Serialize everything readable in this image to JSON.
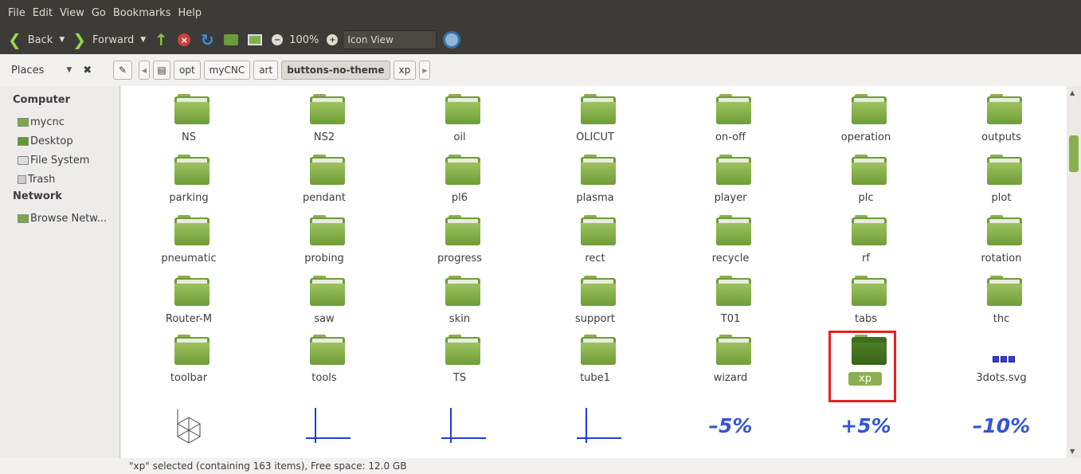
{
  "menu": [
    "File",
    "Edit",
    "View",
    "Go",
    "Bookmarks",
    "Help"
  ],
  "toolbar": {
    "back": "Back",
    "forward": "Forward",
    "zoom": "100%",
    "view_mode": "Icon View"
  },
  "location": {
    "places_label": "Places",
    "crumbs": [
      "opt",
      "myCNC",
      "art",
      "buttons-no-theme",
      "xp"
    ]
  },
  "sidebar": {
    "computer_header": "Computer",
    "computer_items": [
      "mycnc",
      "Desktop",
      "File System",
      "Trash"
    ],
    "network_header": "Network",
    "network_items": [
      "Browse Netw..."
    ]
  },
  "rows": [
    [
      "NS",
      "NS2",
      "oil",
      "OLICUT",
      "on-off",
      "operation",
      "outputs"
    ],
    [
      "parking",
      "pendant",
      "pl6",
      "plasma",
      "player",
      "plc",
      "plot"
    ],
    [
      "pneumatic",
      "probing",
      "progress",
      "rect",
      "recycle",
      "rf",
      "rotation"
    ],
    [
      "Router-M",
      "saw",
      "skin",
      "support",
      "T01",
      "tabs",
      "thc"
    ],
    [
      "toolbar",
      "tools",
      "TS",
      "tube1",
      "wizard",
      "xp",
      "3dots.svg"
    ]
  ],
  "selected_item": "xp",
  "last_row_labels": [
    "–5%",
    "+5%",
    "–10%"
  ],
  "status": "\"xp\" selected (containing 163 items), Free space: 12.0 GB"
}
